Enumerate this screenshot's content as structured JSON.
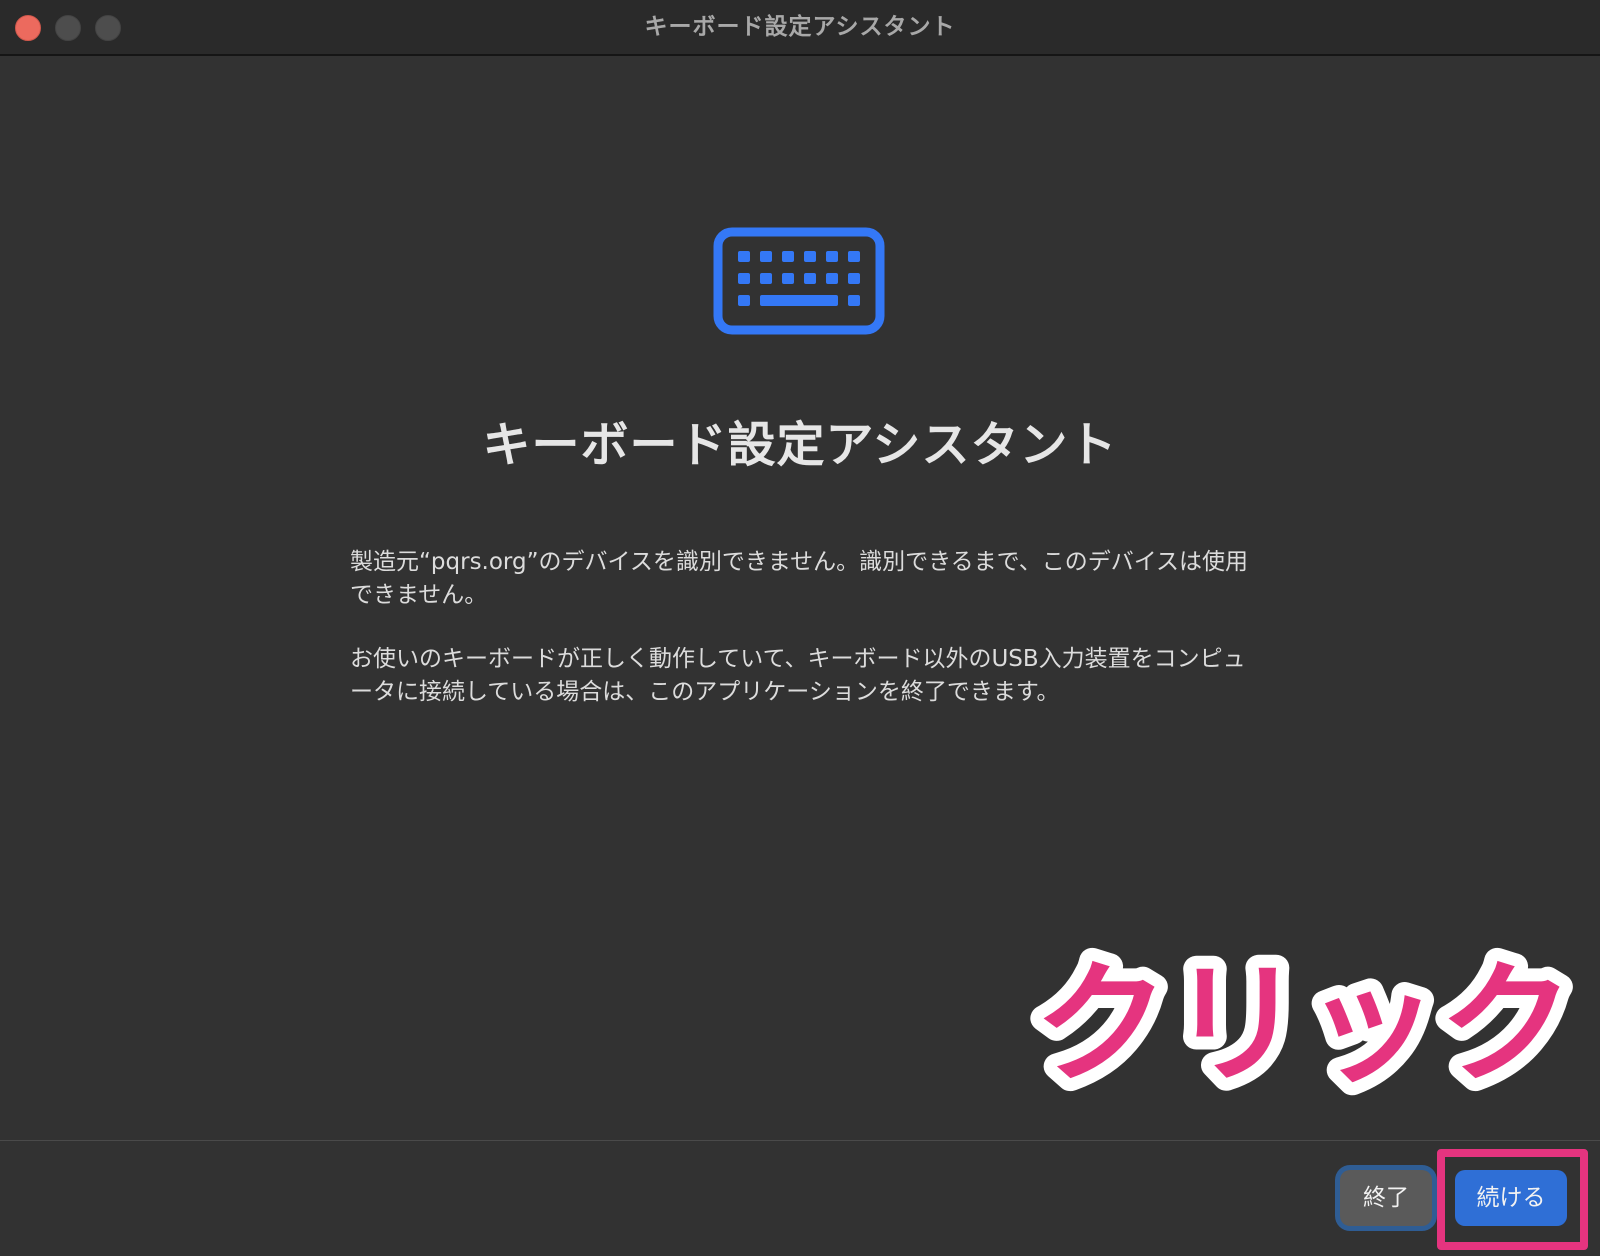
{
  "window": {
    "title": "キーボード設定アシスタント"
  },
  "content": {
    "icon": "keyboard-icon",
    "heading": "キーボード設定アシスタント",
    "paragraph1": "製造元“pqrs.org”のデバイスを識別できません。識別できるまで、このデバイスは使用できません。",
    "paragraph2": "お使いのキーボードが正しく動作していて、キーボード以外のUSB入力装置をコンピュータに接続している場合は、このアプリケーションを終了できます。"
  },
  "footer": {
    "quit_label": "終了",
    "continue_label": "続ける"
  },
  "annotation": {
    "text": "クリック",
    "color": "#e5347f"
  },
  "colors": {
    "accent": "#2f6fd6",
    "icon": "#3478f6",
    "close": "#ec6a5e"
  }
}
